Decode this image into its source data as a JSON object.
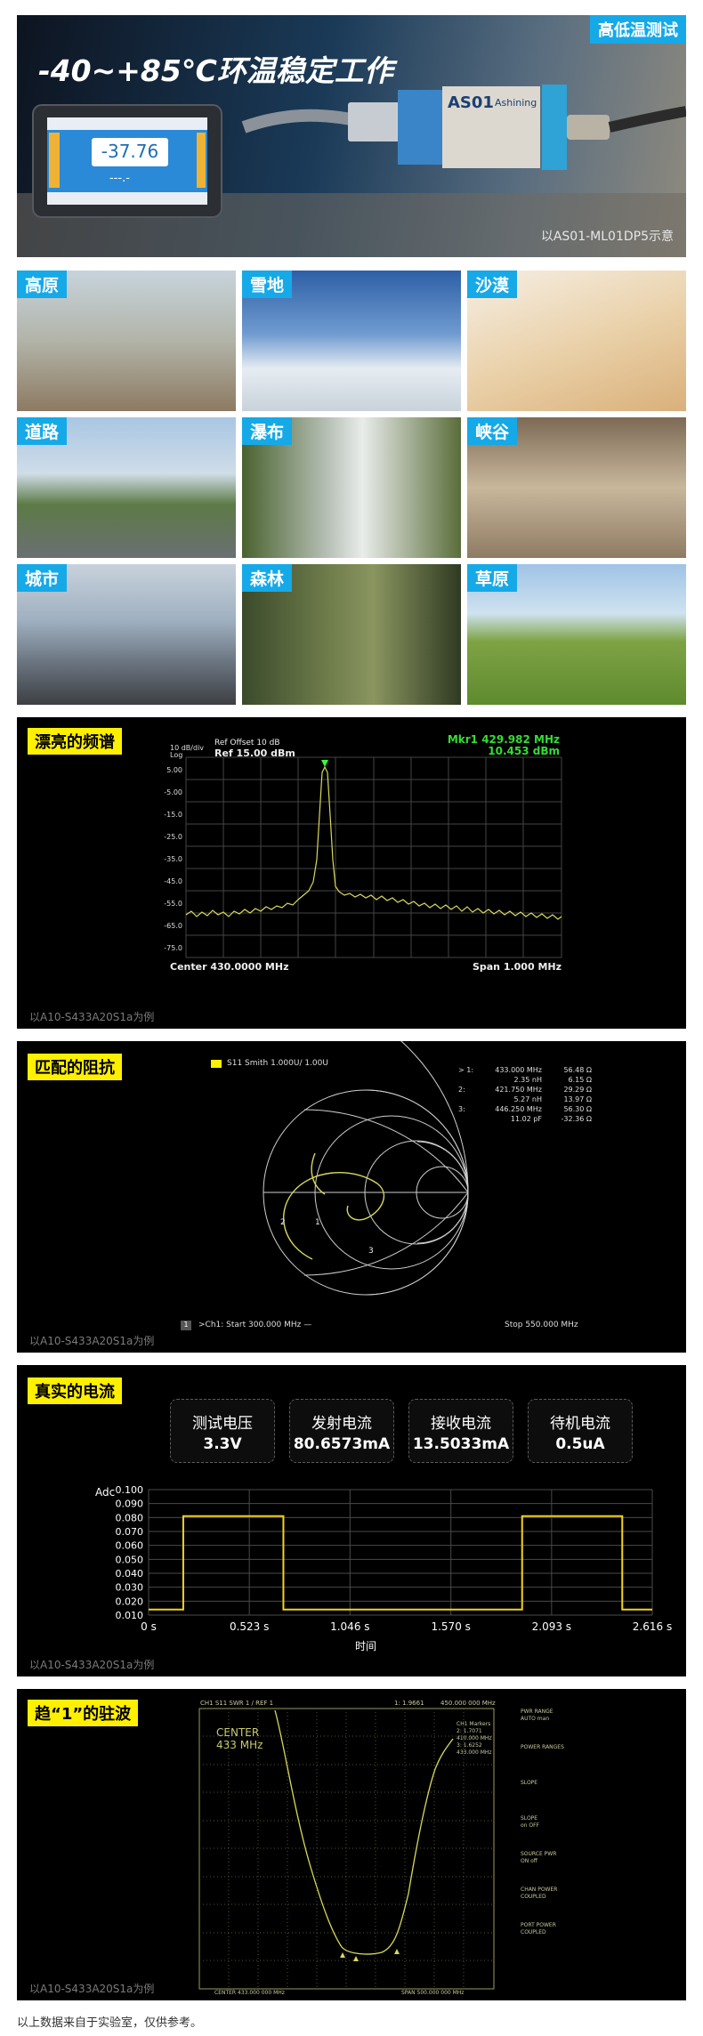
{
  "hero": {
    "title": "-40~+85℃环温稳定工作",
    "tag": "高低温测试",
    "caption": "以AS01-ML01DP5示意",
    "device_display_value": "-37.76",
    "device_display_sub": "---.-",
    "module_label": "AS01",
    "module_brand": "Ashining"
  },
  "environments": [
    "高原",
    "雪地",
    "沙漠",
    "道路",
    "瀑布",
    "峡谷",
    "城市",
    "森林",
    "草原"
  ],
  "spectrum": {
    "tag": "漂亮的频谱",
    "ref_offset": "Ref Offset 10 dB",
    "ref_level": "Ref 15.00 dBm",
    "scale": "10 dB/div",
    "log": "Log",
    "marker": "Mkr1 429.982 MHz",
    "marker_level": "10.453 dBm",
    "center": "Center 430.0000 MHz",
    "span": "Span 1.000 MHz",
    "y_ticks": [
      "5.00",
      "-5.00",
      "-15.0",
      "-25.0",
      "-35.0",
      "-45.0",
      "-55.0",
      "-65.0",
      "-75.0"
    ],
    "caption": "以A10-S433A20S1a为例"
  },
  "smith": {
    "tag": "匹配的阻抗",
    "legend": "S11 Smith 1.000U/ 1.00U",
    "markers": [
      {
        "id": "> 1:",
        "freq": "433.000 MHz",
        "val": "56.48 Ω"
      },
      {
        "id": "",
        "freq": "2.35 nH",
        "val": "6.15 Ω"
      },
      {
        "id": "2:",
        "freq": "421.750 MHz",
        "val": "29.29 Ω"
      },
      {
        "id": "",
        "freq": "5.27 nH",
        "val": "13.97 Ω"
      },
      {
        "id": "3:",
        "freq": "446.250 MHz",
        "val": "56.30 Ω"
      },
      {
        "id": "",
        "freq": "11.02 pF",
        "val": "-32.36 Ω"
      }
    ],
    "channel_num": "1",
    "start": ">Ch1: Start  300.000 MHz —",
    "stop": "Stop  550.000 MHz",
    "caption": "以A10-S433A20S1a为例"
  },
  "current": {
    "tag": "真实的电流",
    "cards": [
      {
        "label": "测试电压",
        "value": "3.3V"
      },
      {
        "label": "发射电流",
        "value": "80.6573mA"
      },
      {
        "label": "接收电流",
        "value": "13.5033mA"
      },
      {
        "label": "待机电流",
        "value": "0.5uA"
      }
    ],
    "y_unit": "Adc",
    "y_ticks": [
      "0.100",
      "0.090",
      "0.080",
      "0.070",
      "0.060",
      "0.050",
      "0.040",
      "0.030",
      "0.020",
      "0.010"
    ],
    "x_ticks": [
      "0 s",
      "0.523 s",
      "1.046 s",
      "1.570 s",
      "2.093 s",
      "2.616 s"
    ],
    "x_label": "时间",
    "caption": "以A10-S433A20S1a为例"
  },
  "vswr": {
    "tag": "趋“1”的驻波",
    "header_left": "CH1  S11   SWR     1   / REF 1",
    "header_mid": "1: 1.9661",
    "header_right": "450.000 000 MHz",
    "center_label": "CENTER",
    "center_freq": "433 MHz",
    "markers_title": "CH1 Markers",
    "marker_lines": [
      "2: 1.7071",
      "410.000 MHz",
      "3: 1.6252",
      "433.000 MHz"
    ],
    "bottom_left": "CENTER 433.000 000 MHz",
    "bottom_right": "SPAN 500.000 000 MHz",
    "softkeys": [
      {
        "title": "PWR RANGE",
        "value": "AUTO  man"
      },
      {
        "title": "POWER RANGES",
        "value": ""
      },
      {
        "title": "SLOPE",
        "value": ""
      },
      {
        "title": "SLOPE",
        "value": "on  OFF"
      },
      {
        "title": "SOURCE PWR",
        "value": "ON  off"
      },
      {
        "title": "CHAN POWER",
        "value": "COUPLED"
      },
      {
        "title": "PORT POWER",
        "value": "COUPLED"
      }
    ],
    "caption": "以A10-S433A20S1a为例"
  },
  "footer": "以上数据来自于实验室，仅供参考。",
  "chart_data": [
    {
      "type": "line",
      "title": "",
      "xlabel": "时间",
      "ylabel": "Adc",
      "ylim": [
        0.01,
        0.1
      ],
      "x_ticks": [
        0,
        0.523,
        1.046,
        1.57,
        2.093,
        2.616
      ],
      "series": [
        {
          "x": [
            0,
            0.18,
            0.18,
            0.7,
            0.7,
            1.94,
            1.94,
            2.46,
            2.46,
            2.616
          ],
          "y": [
            0.014,
            0.014,
            0.081,
            0.081,
            0.014,
            0.014,
            0.081,
            0.081,
            0.014,
            0.014
          ]
        }
      ]
    }
  ]
}
